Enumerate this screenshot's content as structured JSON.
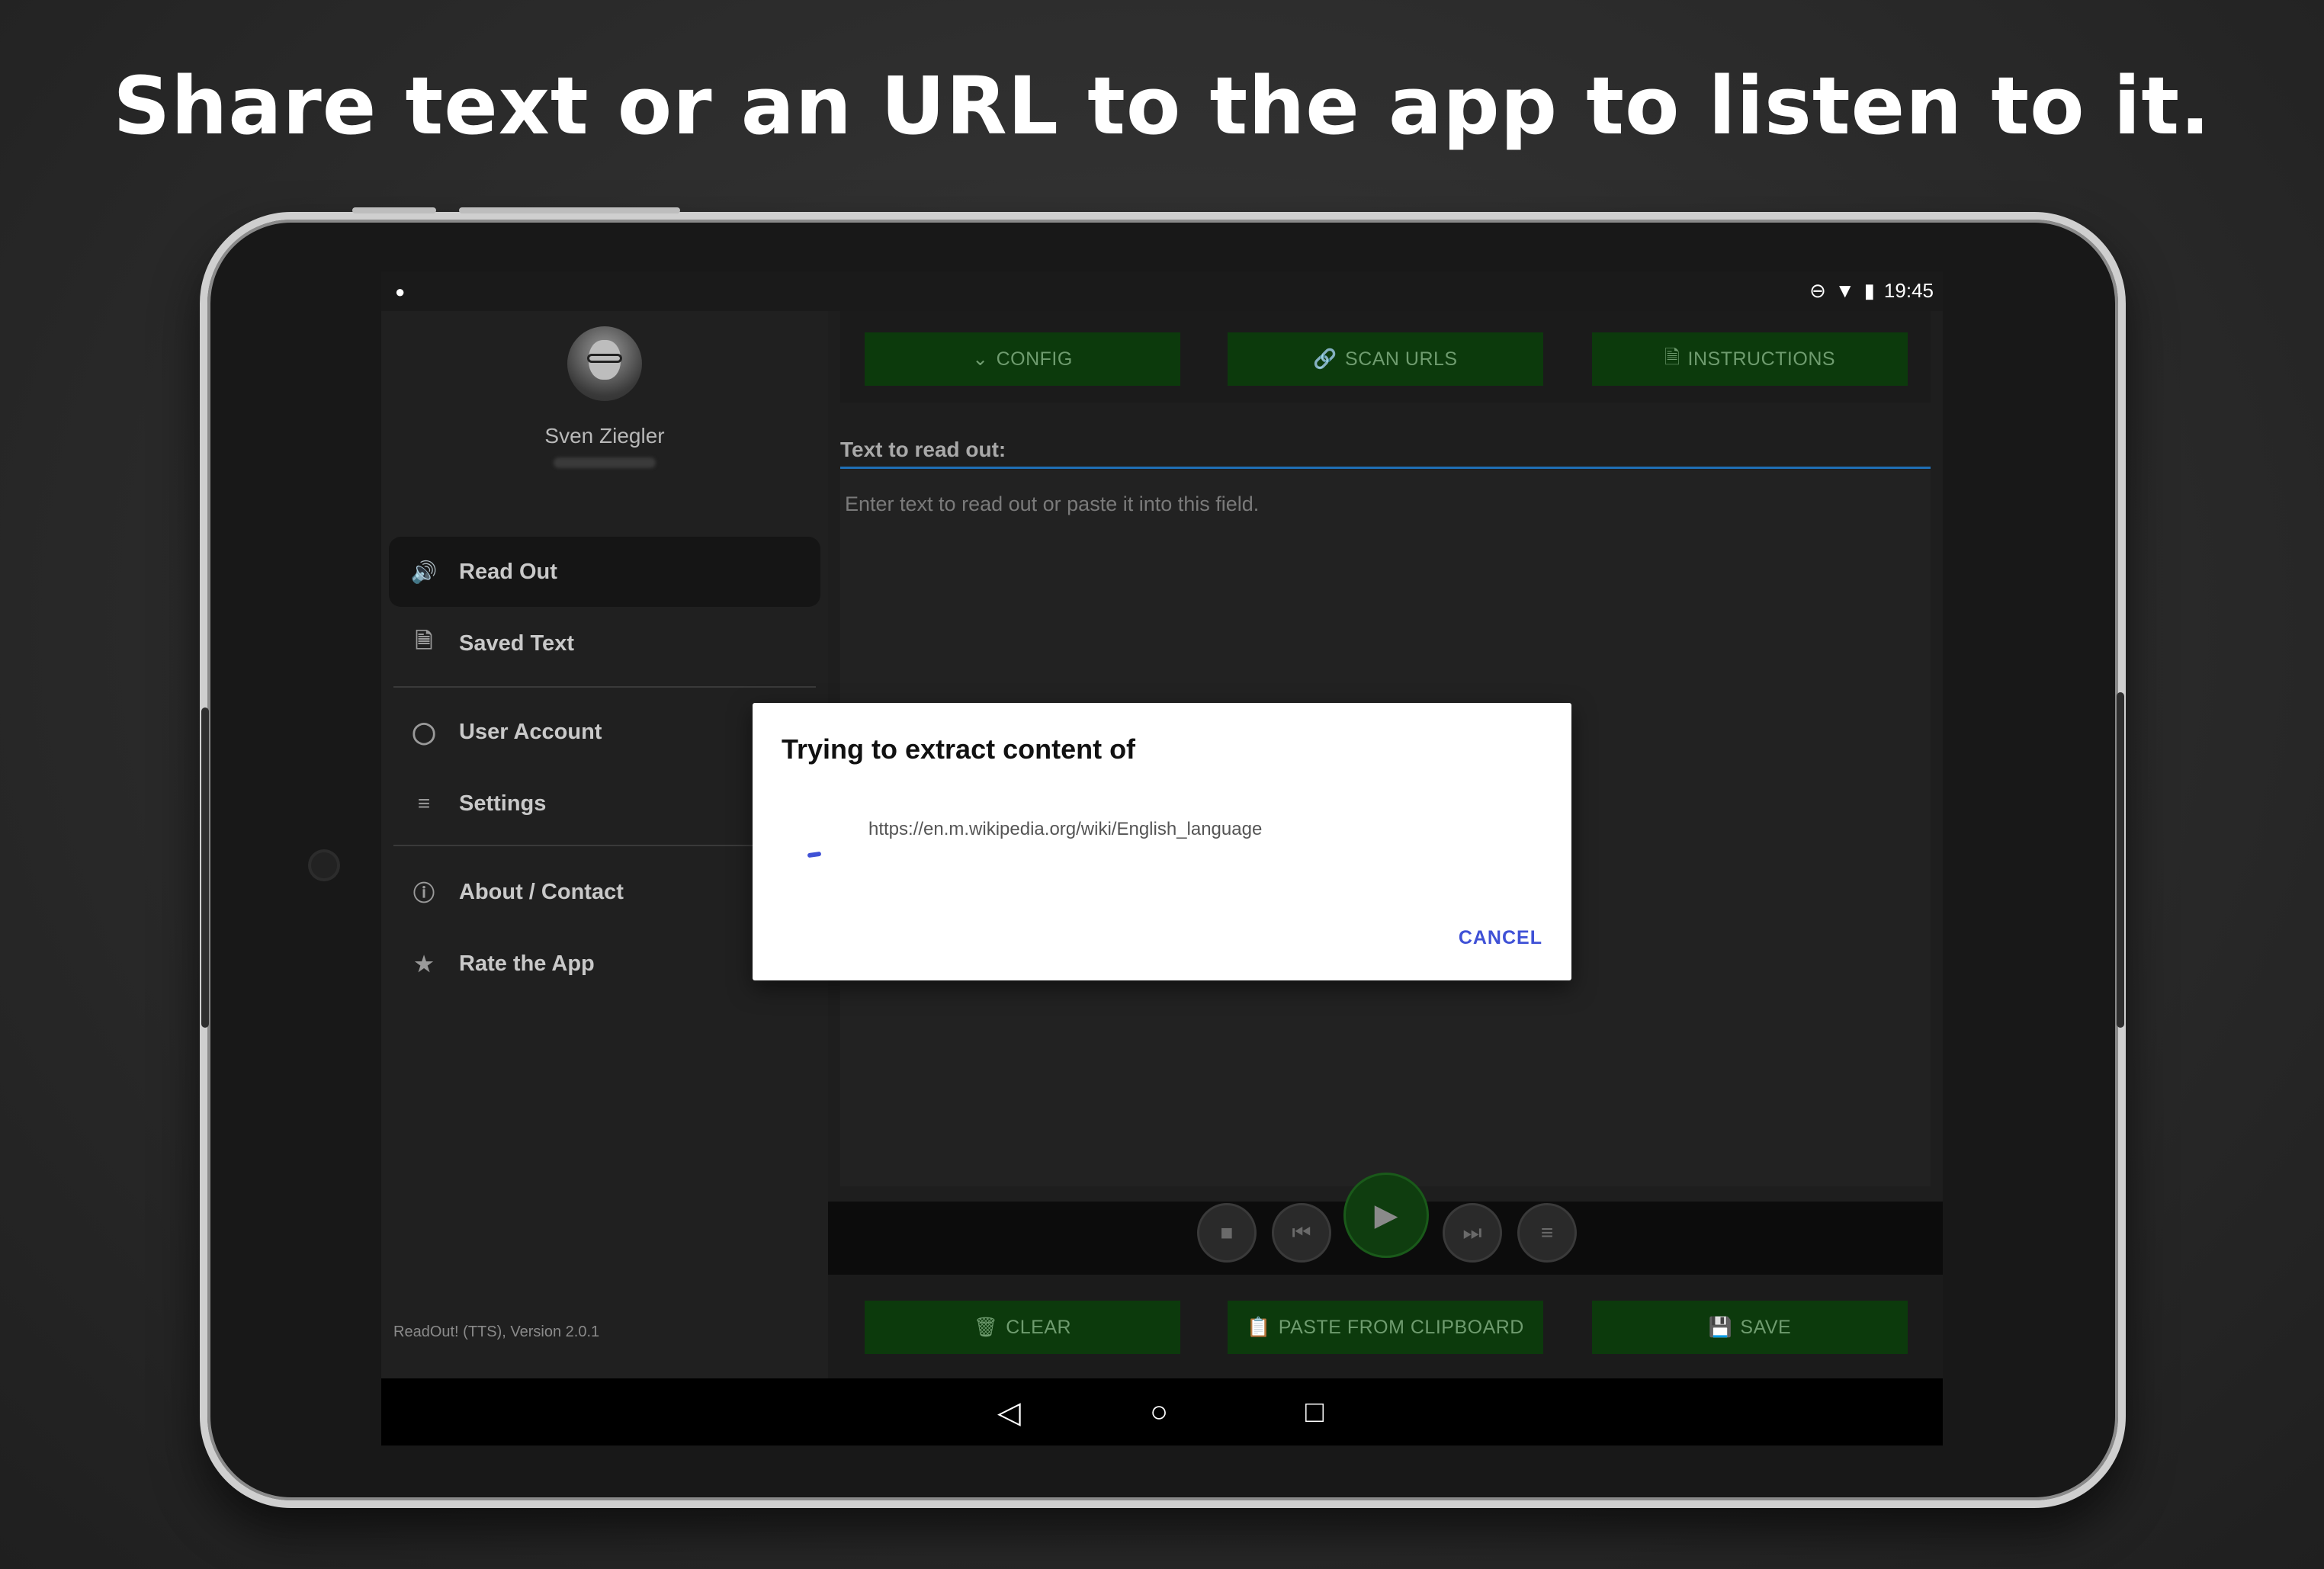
{
  "headline": "Share text or an URL to the app to listen to it.",
  "statusbar": {
    "time": "19:45"
  },
  "drawer": {
    "user_name": "Sven Ziegler",
    "items": [
      {
        "label": "Read Out",
        "icon": "speaker-icon"
      },
      {
        "label": "Saved Text",
        "icon": "document-icon"
      },
      {
        "label": "User Account",
        "icon": "user-icon"
      },
      {
        "label": "Settings",
        "icon": "sliders-icon"
      },
      {
        "label": "About / Contact",
        "icon": "help-icon"
      },
      {
        "label": "Rate the App",
        "icon": "star-icon"
      }
    ],
    "version": "ReadOut! (TTS), Version 2.0.1"
  },
  "topbar": {
    "config": "CONFIG",
    "scan_urls": "SCAN URLS",
    "instructions": "INSTRUCTIONS"
  },
  "text_field": {
    "label": "Text to read out:",
    "placeholder": "Enter text to read out or paste it into this field."
  },
  "bottombar": {
    "clear": "CLEAR",
    "paste": "PASTE FROM CLIPBOARD",
    "save": "SAVE"
  },
  "dialog": {
    "title": "Trying to extract content of",
    "url": "https://en.m.wikipedia.org/wiki/English_language",
    "cancel": "CANCEL"
  },
  "colors": {
    "button_green": "#0c3a0c",
    "accent_blue": "#3f51d6",
    "field_line": "#1f6fb6"
  }
}
